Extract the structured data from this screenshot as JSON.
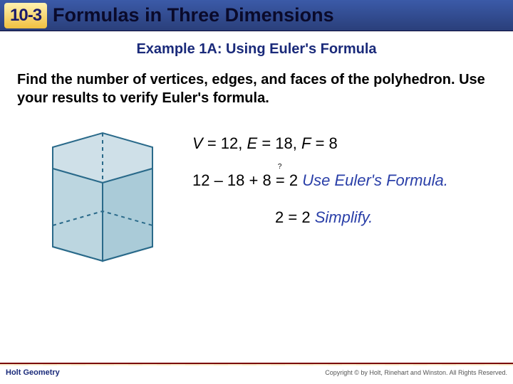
{
  "header": {
    "section": "10-3",
    "title": "Formulas in Three Dimensions"
  },
  "subtitle": "Example 1A: Using Euler's Formula",
  "prompt": "Find the number of vertices, edges, and faces of the polyhedron. Use your results to verify Euler's formula.",
  "values": {
    "V_label": "V",
    "V": "12",
    "E_label": "E",
    "E": "18",
    "F_label": "F",
    "F": "8"
  },
  "steps": {
    "line1_expr": "12 – 18 + 8",
    "line1_q": "?",
    "line1_eq": "=",
    "line1_rhs": "2",
    "line1_note": "Use Euler's Formula.",
    "line2_lhs": "2",
    "line2_eq": "=",
    "line2_rhs": "2",
    "line2_note": "Simplify."
  },
  "footer": {
    "left": "Holt Geometry",
    "right": "Copyright © by Holt, Rinehart and Winston. All Rights Reserved."
  },
  "shape": {
    "name": "hexagonal-prism"
  }
}
